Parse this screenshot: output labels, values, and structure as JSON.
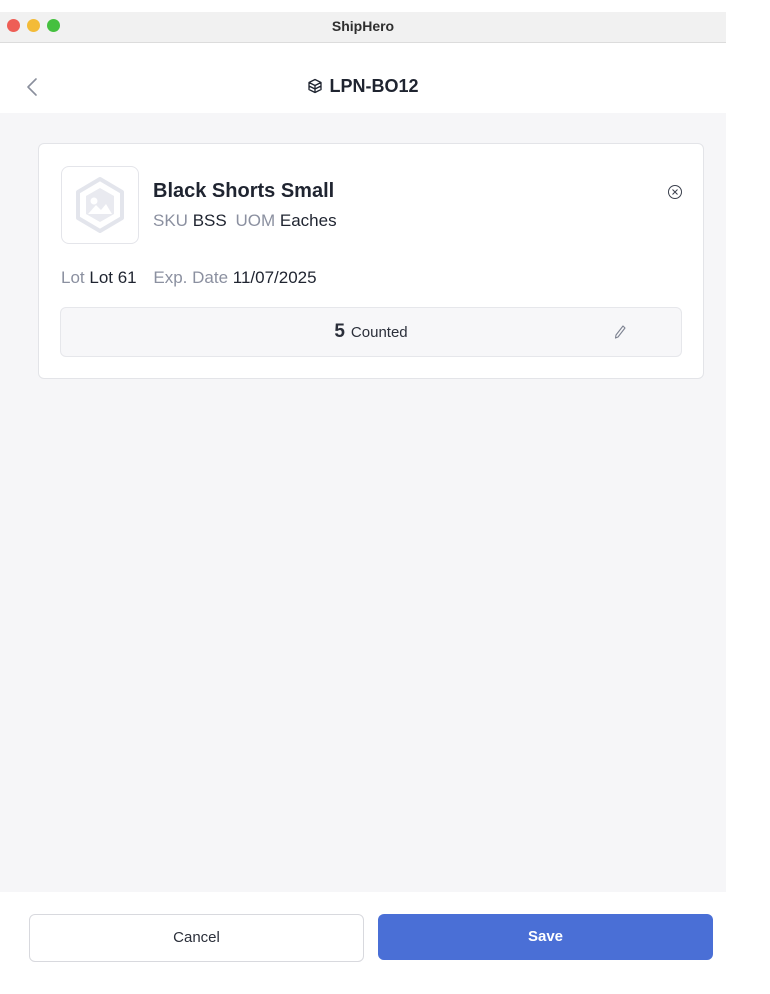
{
  "window": {
    "title": "ShipHero"
  },
  "nav": {
    "title": "LPN-BO12",
    "back_icon": "chevron-left-icon",
    "title_icon": "package-icon"
  },
  "item": {
    "name": "Black Shorts Small",
    "sku_label": "SKU",
    "sku_value": "BSS",
    "uom_label": "UOM",
    "uom_value": "Eaches",
    "lot_label": "Lot",
    "lot_value": "Lot 61",
    "exp_label": "Exp. Date",
    "exp_value": "11/07/2025",
    "count": "5",
    "count_label": "Counted",
    "image_icon": "image-placeholder-icon",
    "remove_icon": "close-circle-icon",
    "edit_icon": "pencil-icon"
  },
  "footer": {
    "cancel_label": "Cancel",
    "save_label": "Save"
  },
  "colors": {
    "accent": "#4a6fd6",
    "background": "#f6f6f8"
  }
}
